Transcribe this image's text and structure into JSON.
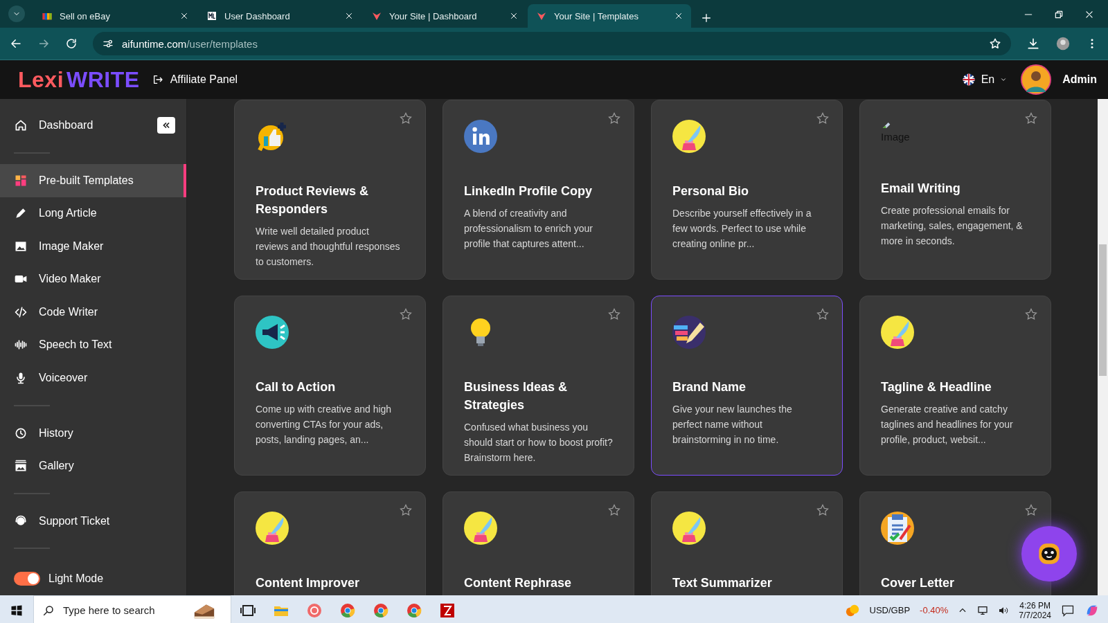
{
  "browser": {
    "tabs": [
      {
        "title": "Sell on eBay",
        "kind": "ebay",
        "selected": false
      },
      {
        "title": "User Dashboard",
        "kind": "ml",
        "selected": false
      },
      {
        "title": "Your Site | Dashboard",
        "kind": "site",
        "selected": false
      },
      {
        "title": "Your Site | Templates",
        "kind": "site",
        "selected": true
      }
    ],
    "address": {
      "host": "aifuntime.com",
      "path": "/user/templates"
    }
  },
  "header": {
    "logo_part_1": "Lexi",
    "logo_part_2": "WRITE",
    "affiliate_link": "Affiliate Panel",
    "language": "En",
    "user": "Admin"
  },
  "sidebar": {
    "sections": [
      [
        {
          "label": "Dashboard",
          "kind": "home",
          "selected": false
        }
      ],
      [
        {
          "label": "Pre-built Templates",
          "kind": "grid",
          "selected": true
        },
        {
          "label": "Long Article",
          "kind": "pen",
          "selected": false
        },
        {
          "label": "Image Maker",
          "kind": "image",
          "selected": false
        },
        {
          "label": "Video Maker",
          "kind": "video",
          "selected": false
        },
        {
          "label": "Code Writer",
          "kind": "code",
          "selected": false
        },
        {
          "label": "Speech to Text",
          "kind": "wave",
          "selected": false
        },
        {
          "label": "Voiceover",
          "kind": "mic",
          "selected": false
        }
      ],
      [
        {
          "label": "History",
          "kind": "history",
          "selected": false
        },
        {
          "label": "Gallery",
          "kind": "gallery",
          "selected": false
        }
      ],
      [
        {
          "label": "Support Ticket",
          "kind": "headset",
          "selected": false
        }
      ]
    ],
    "mode_toggle": {
      "label": "Light Mode",
      "on": true
    }
  },
  "templates": [
    {
      "title": "Product Reviews & Responders",
      "description": "Write well detailed product reviews and thoughtful responses to customers.",
      "kind": "thumbs",
      "selected": false,
      "favorite": false
    },
    {
      "title": "LinkedIn Profile Copy",
      "description": "A blend of creativity and professionalism to enrich your profile that captures attent...",
      "kind": "linkedin",
      "selected": false,
      "favorite": false
    },
    {
      "title": "Personal Bio",
      "description": "Describe yourself effectively in a few words. Perfect to use while creating online pr...",
      "kind": "quill",
      "selected": false,
      "favorite": false
    },
    {
      "title": "Email Writing",
      "description": "Create professional emails for marketing, sales, engagement, & more in seconds.",
      "kind": "broken",
      "icon_alt": "Image",
      "selected": false,
      "favorite": false
    },
    {
      "title": "Call to Action",
      "description": "Come up with creative and high converting CTAs for your ads, posts, landing pages, an...",
      "kind": "megaphone",
      "selected": false,
      "favorite": false
    },
    {
      "title": "Business Ideas & Strategies",
      "description": "Confused what business you should start or how to boost profit? Brainstorm here.",
      "kind": "bulb",
      "selected": false,
      "favorite": false
    },
    {
      "title": "Brand Name",
      "description": "Give your new launches the perfect name without brainstorming in no time.",
      "kind": "brand",
      "selected": true,
      "favorite": false
    },
    {
      "title": "Tagline & Headline",
      "description": "Generate creative and catchy taglines and headlines for your profile, product, websit...",
      "kind": "quill",
      "selected": false,
      "favorite": false
    },
    {
      "title": "Content Improver",
      "kind": "quill",
      "selected": false,
      "favorite": false
    },
    {
      "title": "Content Rephrase",
      "kind": "quill",
      "selected": false,
      "favorite": false
    },
    {
      "title": "Text Summarizer",
      "kind": "quill",
      "selected": false,
      "favorite": false
    },
    {
      "title": "Cover Letter",
      "kind": "clipboard",
      "selected": false,
      "favorite": false
    }
  ],
  "taskbar": {
    "search_placeholder": "Type here to search",
    "ticker": {
      "pair": "USD/GBP",
      "change": "-0.40%"
    },
    "time": "4:26 PM",
    "date": "7/7/2024"
  }
}
